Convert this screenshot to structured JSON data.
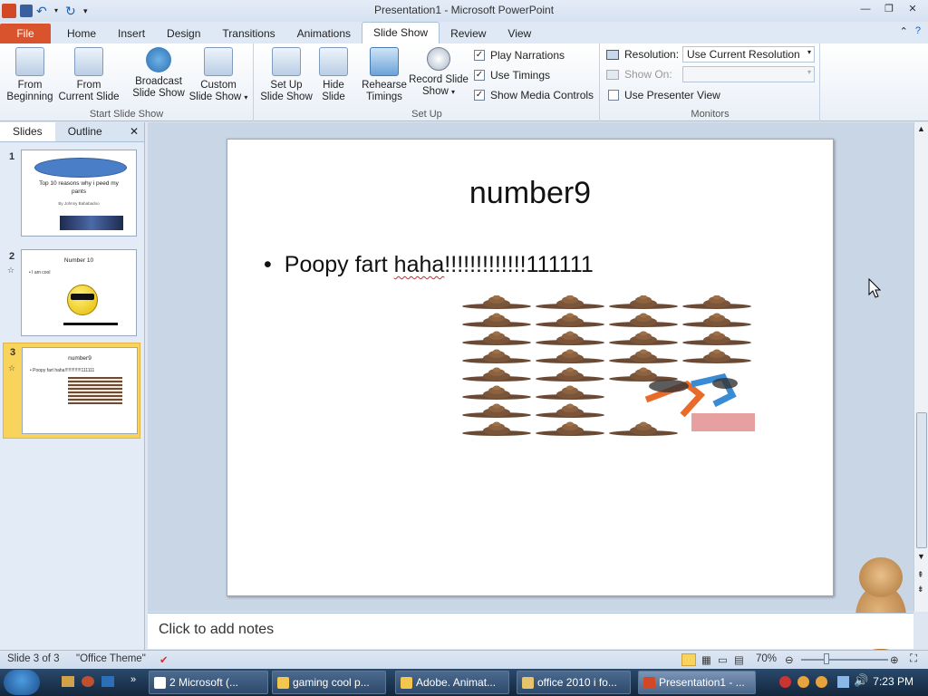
{
  "window": {
    "title": "Presentation1 - Microsoft PowerPoint"
  },
  "tabs": [
    {
      "label": "File"
    },
    {
      "label": "Home"
    },
    {
      "label": "Insert"
    },
    {
      "label": "Design"
    },
    {
      "label": "Transitions"
    },
    {
      "label": "Animations"
    },
    {
      "label": "Slide Show"
    },
    {
      "label": "Review"
    },
    {
      "label": "View"
    }
  ],
  "ribbon": {
    "start": {
      "group_label": "Start Slide Show",
      "from_beginning": [
        "From",
        "Beginning"
      ],
      "from_current": [
        "From",
        "Current Slide"
      ],
      "broadcast": [
        "Broadcast",
        "Slide Show"
      ],
      "custom": [
        "Custom",
        "Slide Show"
      ]
    },
    "setup": {
      "group_label": "Set Up",
      "setup_btn": [
        "Set Up",
        "Slide Show"
      ],
      "hide": [
        "Hide",
        "Slide"
      ],
      "rehearse": [
        "Rehearse",
        "Timings"
      ],
      "record": [
        "Record Slide",
        "Show"
      ],
      "play_narrations": "Play Narrations",
      "use_timings": "Use Timings",
      "show_media": "Show Media Controls"
    },
    "monitors": {
      "group_label": "Monitors",
      "resolution_label": "Resolution:",
      "resolution_value": "Use Current Resolution",
      "show_on_label": "Show On:",
      "presenter_view": "Use Presenter View"
    }
  },
  "slides_pane": {
    "tabs": [
      "Slides",
      "Outline"
    ],
    "thumbs": [
      {
        "num": "1",
        "title": "Top 10 reasons why i peed my pants",
        "sub": "By Johnny Bababadoo"
      },
      {
        "num": "2",
        "title": "Number 10",
        "bullet": "• I am cool"
      },
      {
        "num": "3",
        "title": "number9",
        "bullet": "• Poopy fart haha!!!!!!!!!!!!!111111"
      }
    ]
  },
  "slide": {
    "title": "number9",
    "bullet_prefix": "Poopy fart ",
    "bullet_squiggle": "haha",
    "bullet_suffix": "!!!!!!!!!!!!!111111"
  },
  "notes": {
    "placeholder": "Click to add notes"
  },
  "status": {
    "slide_count": "Slide 3 of 3",
    "theme": "\"Office Theme\"",
    "zoom": "70%"
  },
  "taskbar": {
    "items": [
      "2 Microsoft (...",
      "gaming cool p...",
      "Adobe. Animat...",
      "office 2010 i fo...",
      "Presentation1 - ..."
    ],
    "clock": "7:23 PM"
  },
  "colors": {
    "file_tab": "#d9532c",
    "selected_thumb": "#f8d45c"
  }
}
